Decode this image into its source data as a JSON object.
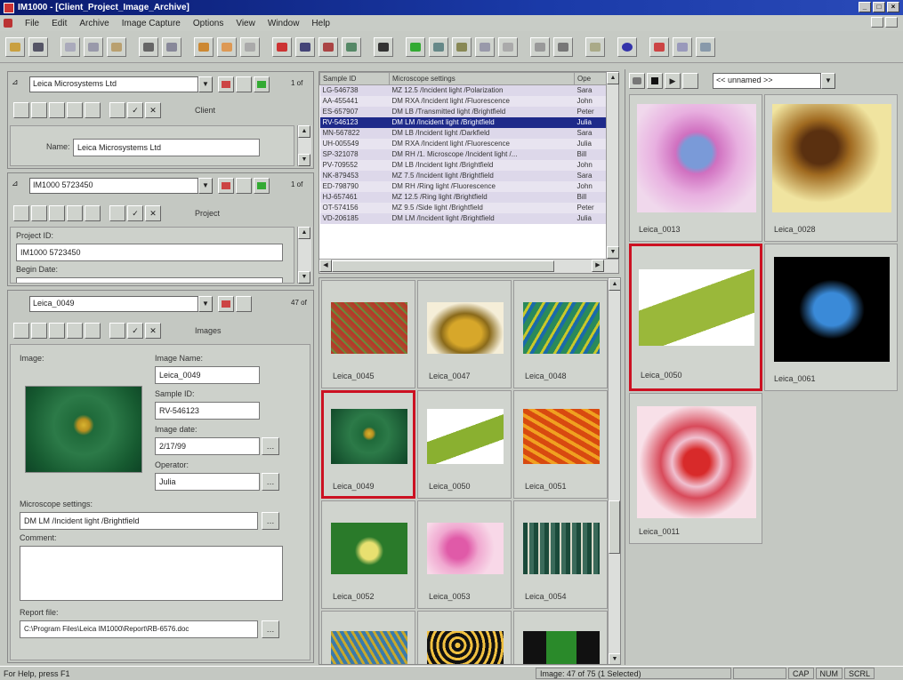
{
  "window": {
    "title": "IM1000 - [Client_Project_Image_Archive]",
    "controls": [
      "_",
      "□",
      "×"
    ]
  },
  "menu": [
    "File",
    "Edit",
    "Archive",
    "Image Capture",
    "Options",
    "View",
    "Window",
    "Help"
  ],
  "client_panel": {
    "combo": "Leica Microsystems Ltd",
    "count": "1 of",
    "tab_label": "Client",
    "name_label": "Name:",
    "name_value": "Leica Microsystems Ltd"
  },
  "project_panel": {
    "combo": "IM1000 5723450",
    "count": "1 of",
    "tab_label": "Project",
    "id_label": "Project ID:",
    "id_value": "IM1000 5723450",
    "begin_label": "Begin Date:"
  },
  "images_panel": {
    "combo": "Leica_0049",
    "count": "47 of",
    "tab_label": "Images",
    "image_label": "Image:",
    "name_label": "Image Name:",
    "name_value": "Leica_0049",
    "sample_label": "Sample ID:",
    "sample_value": "RV-546123",
    "date_label": "Image date:",
    "date_value": "2/17/99",
    "operator_label": "Operator:",
    "operator_value": "Julia",
    "micro_label": "Microscope settings:",
    "micro_value": "DM LM /Incident light /Brightfield",
    "comment_label": "Comment:",
    "report_label": "Report file:",
    "report_value": "C:\\Program Files\\Leica IM1000\\Report\\RB-6576.doc"
  },
  "sample_table": {
    "headers": [
      "Sample ID",
      "Microscope settings",
      "Ope"
    ],
    "rows": [
      [
        "LG-546738",
        "MZ 12.5 /Incident light /Polarization",
        "Sara"
      ],
      [
        "AA-455441",
        "DM RXA /Incident light /Fluorescence",
        "John"
      ],
      [
        "ES-657907",
        "DM LB /Transmitted light /Brightfield",
        "Peter"
      ],
      [
        "RV-546123",
        "DM LM /Incident light /Brightfield",
        "Julia"
      ],
      [
        "MN-567822",
        "DM LB /Incident light /Darkfield",
        "Sara"
      ],
      [
        "UH-005549",
        "DM RXA /Incident light /Fluorescence",
        "Julia"
      ],
      [
        "SP-321078",
        "DM RH /1. Microscope /Incident light /...",
        "Bill"
      ],
      [
        "PV-709552",
        "DM LB /Incident light /Brightfield",
        "John"
      ],
      [
        "NK-879453",
        "MZ 7.5 /Incident light /Brightfield",
        "Sara"
      ],
      [
        "ED-798790",
        "DM RH /Ring light /Fluorescence",
        "John"
      ],
      [
        "HJ-657461",
        "MZ 12.5 /Ring light /Brightfield",
        "Bill"
      ],
      [
        "OT-574156",
        "MZ 9.5 /Side light /Brightfield",
        "Peter"
      ],
      [
        "VD-206185",
        "DM LM /Incident light /Brightfield",
        "Julia"
      ]
    ],
    "highlight_index": 3
  },
  "thumbs_mid": [
    "Leica_0045",
    "Leica_0047",
    "Leica_0048",
    "Leica_0049",
    "Leica_0050",
    "Leica_0051",
    "Leica_0052",
    "Leica_0053",
    "Leica_0054"
  ],
  "right_panel": {
    "combo": "<< unnamed >>",
    "thumbs": [
      "Leica_0013",
      "Leica_0028",
      "Leica_0050",
      "Leica_0061",
      "Leica_0011"
    ]
  },
  "status": {
    "help": "For Help, press F1",
    "image": "Image: 47 of 75 (1 Selected)",
    "caps": "CAP",
    "num": "NUM",
    "scrl": "SCRL"
  },
  "colors": {
    "accent": "#1e2a8a",
    "selection": "#cc1122"
  }
}
